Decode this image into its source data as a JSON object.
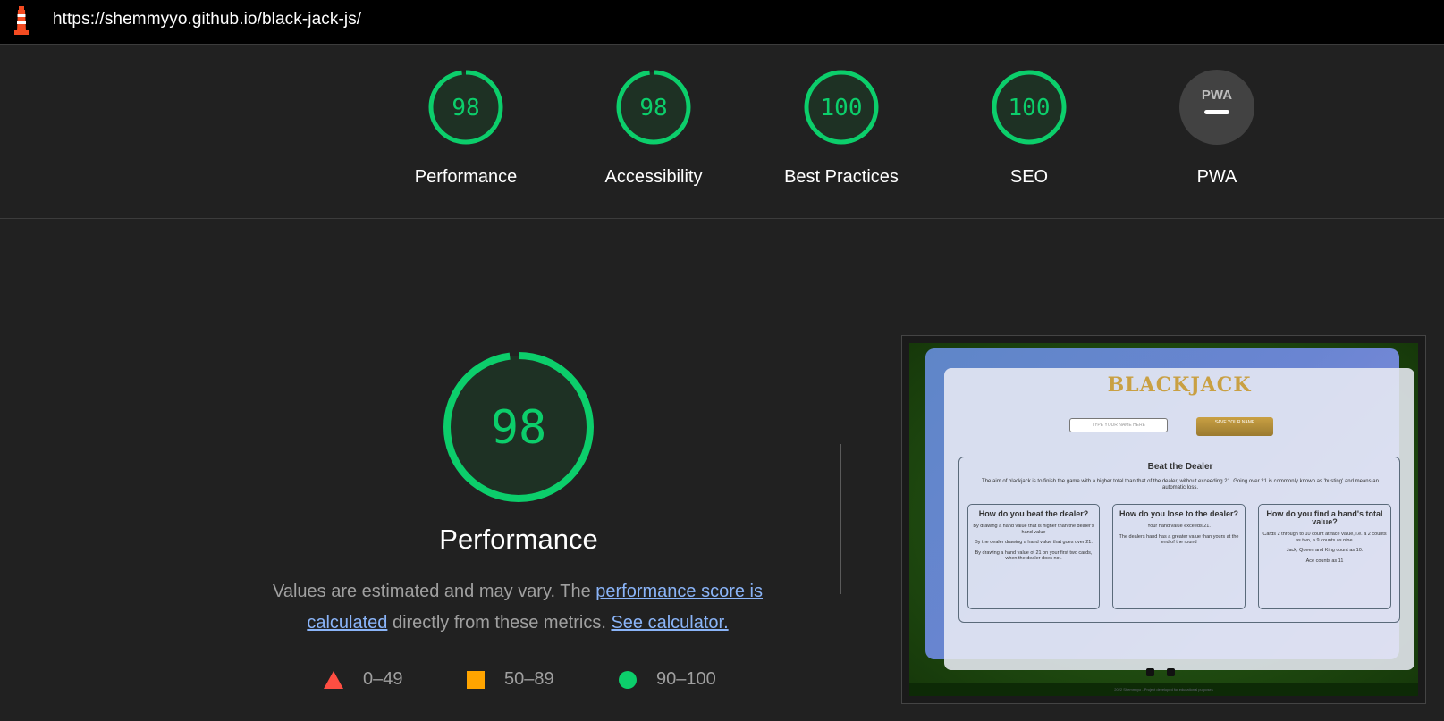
{
  "browser": {
    "url": "https://shemmyyo.github.io/black-jack-js/"
  },
  "colors": {
    "pass": "#0cce6b",
    "average": "#ffa400",
    "fail": "#ff4e42",
    "gauge_fill": "#1e3124"
  },
  "scores": [
    {
      "label": "Performance",
      "value": "98",
      "score": 98
    },
    {
      "label": "Accessibility",
      "value": "98",
      "score": 98
    },
    {
      "label": "Best Practices",
      "value": "100",
      "score": 100
    },
    {
      "label": "SEO",
      "value": "100",
      "score": 100
    },
    {
      "label": "PWA",
      "badge": "PWA"
    }
  ],
  "performance": {
    "score": "98",
    "title": "Performance",
    "desc_prefix": "Values are estimated and may vary. The ",
    "desc_link1": "performance score is calculated",
    "desc_middle": " directly from these metrics. ",
    "desc_link2": "See calculator."
  },
  "legend": [
    {
      "range": "0–49",
      "icon": "triangle-icon"
    },
    {
      "range": "50–89",
      "icon": "square-icon"
    },
    {
      "range": "90–100",
      "icon": "circle-icon"
    }
  ],
  "screenshot": {
    "title": "BLACKJACK",
    "name_placeholder": "TYPE YOUR NAME HERE",
    "save_label": "SAVE YOUR NAME",
    "beat_title": "Beat the Dealer",
    "aim": "The aim of blackjack is to finish the game with a higher total than that of the dealer, without exceeding 21. Going over 21 is commonly known as 'busting' and means an automatic loss.",
    "col1_title": "How do you beat the dealer?",
    "col1_p1": "By drawing a hand value that is higher than the dealer's hand value",
    "col1_p2": "By the dealer drawing a hand value that goes over 21.",
    "col1_p3": "By drawing a hand value of 21 on your first two cards, when the dealer does not.",
    "col2_title": "How do you lose to the dealer?",
    "col2_p1": "Your hand value exceeds 21.",
    "col2_p2": "The dealers hand has a greater value than yours at the end of the round",
    "col3_title": "How do you find a hand's total value?",
    "col3_p1": "Cards 2 through to 10 count at face value, i.e. a 2 counts as two, a 9 counts as nine.",
    "col3_p2": "Jack, Queen and King count as 10.",
    "col3_p3": "Ace counts as 11",
    "footer": "2022 Shemmyyo - Project developed for educational purposes"
  }
}
